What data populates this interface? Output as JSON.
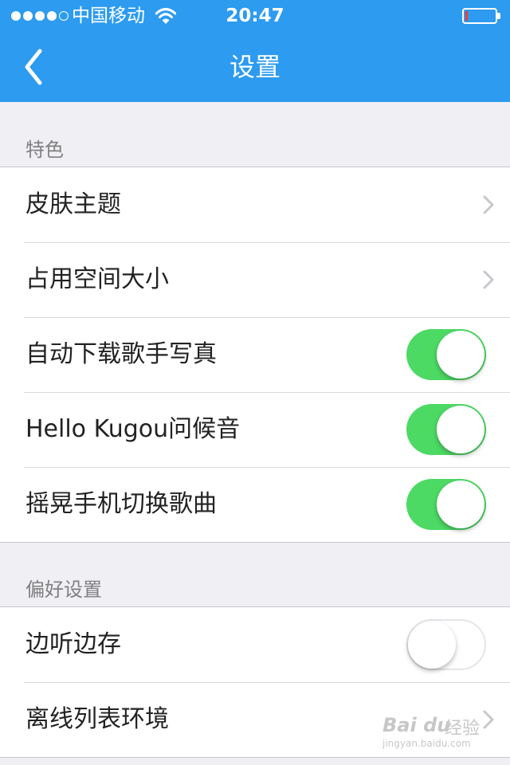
{
  "status_bar": {
    "carrier": "中国移动",
    "time": "20:47",
    "battery_level": 0.08,
    "signal_bars_filled": 4,
    "signal_bars_total": 5
  },
  "nav": {
    "title": "设置",
    "back_icon": "chevron-left-icon"
  },
  "colors": {
    "accent": "#2c9bf0",
    "toggle_on": "#4cd964",
    "background": "#efeff4"
  },
  "sections": [
    {
      "header": "特色",
      "rows": [
        {
          "label": "皮肤主题",
          "control": "chevron"
        },
        {
          "label": "占用空间大小",
          "control": "chevron"
        },
        {
          "label": "自动下载歌手写真",
          "control": "toggle",
          "on": true
        },
        {
          "label": "Hello Kugou问候音",
          "control": "toggle",
          "on": true
        },
        {
          "label": "摇晃手机切换歌曲",
          "control": "toggle",
          "on": true
        }
      ]
    },
    {
      "header": "偏好设置",
      "rows": [
        {
          "label": "边听边存",
          "control": "toggle",
          "on": false
        },
        {
          "label": "离线列表环境",
          "control": "chevron"
        }
      ]
    }
  ],
  "watermark": {
    "logo": "Bai du",
    "text": "经验",
    "url": "jingyan.baidu.com"
  }
}
